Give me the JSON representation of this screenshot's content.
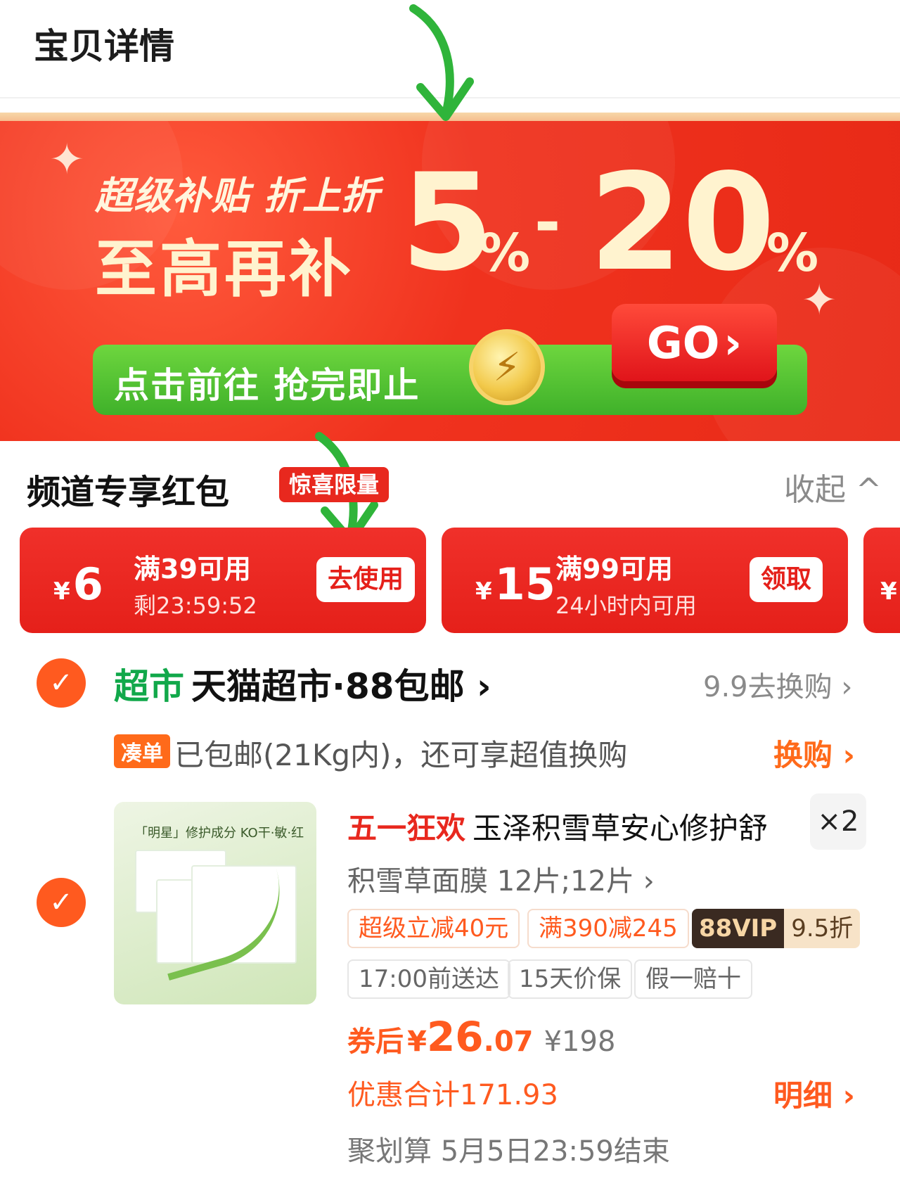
{
  "header": {
    "title": "宝贝详情"
  },
  "banner": {
    "subtitle": "超级补贴 折上折",
    "headline": "至高再补",
    "num1": "5",
    "pct": "%",
    "dash": "-",
    "num2": "20",
    "cta_text": "点击前往 抢完即止",
    "go_label": "GO",
    "go_arrow": "›"
  },
  "coupons": {
    "heading": "频道专享红包",
    "badge": "惊喜限量",
    "collapse_label": "收起",
    "collapse_icon": "^",
    "currency": "¥",
    "items": [
      {
        "amount": "6",
        "condition": "满39可用",
        "sub": "剩23:59:52",
        "button": "去使用"
      },
      {
        "amount": "15",
        "condition": "满99可用",
        "sub": "24小时内可用",
        "button": "领取"
      },
      {
        "amount": ""
      }
    ]
  },
  "store": {
    "check_icon": "✓",
    "tag": "超市",
    "name": "天猫超市·88包邮",
    "name_arrow": "›",
    "swap_offer": "9.9去换购 ›",
    "coudan_tag": "凑单",
    "coudan_text": "已包邮(21Kg内)，还可享超值换购",
    "swap_link": "换购 ›"
  },
  "product": {
    "image_label": "「明星」修护成分 KO干·敏·红",
    "promo_tag": "五一狂欢",
    "title": "玉泽积雪草安心修护舒",
    "quantity": "×2",
    "sku": "积雪草面膜 12片;12片 ›",
    "tags": [
      "超级立减40元",
      "满390减245"
    ],
    "vip_label": "88VIP",
    "vip_discount": "9.5折",
    "service_tags": [
      "17:00前送达",
      "15天价保",
      "假一赔十"
    ],
    "price_label": "券后",
    "price_currency": "¥",
    "price_int": "26",
    "price_dec": ".07",
    "original_price": "¥198",
    "discount_total": "优惠合计171.93",
    "detail_link": "明细 ›",
    "juhuasuan": "聚划算 5月5日23:59结束"
  }
}
